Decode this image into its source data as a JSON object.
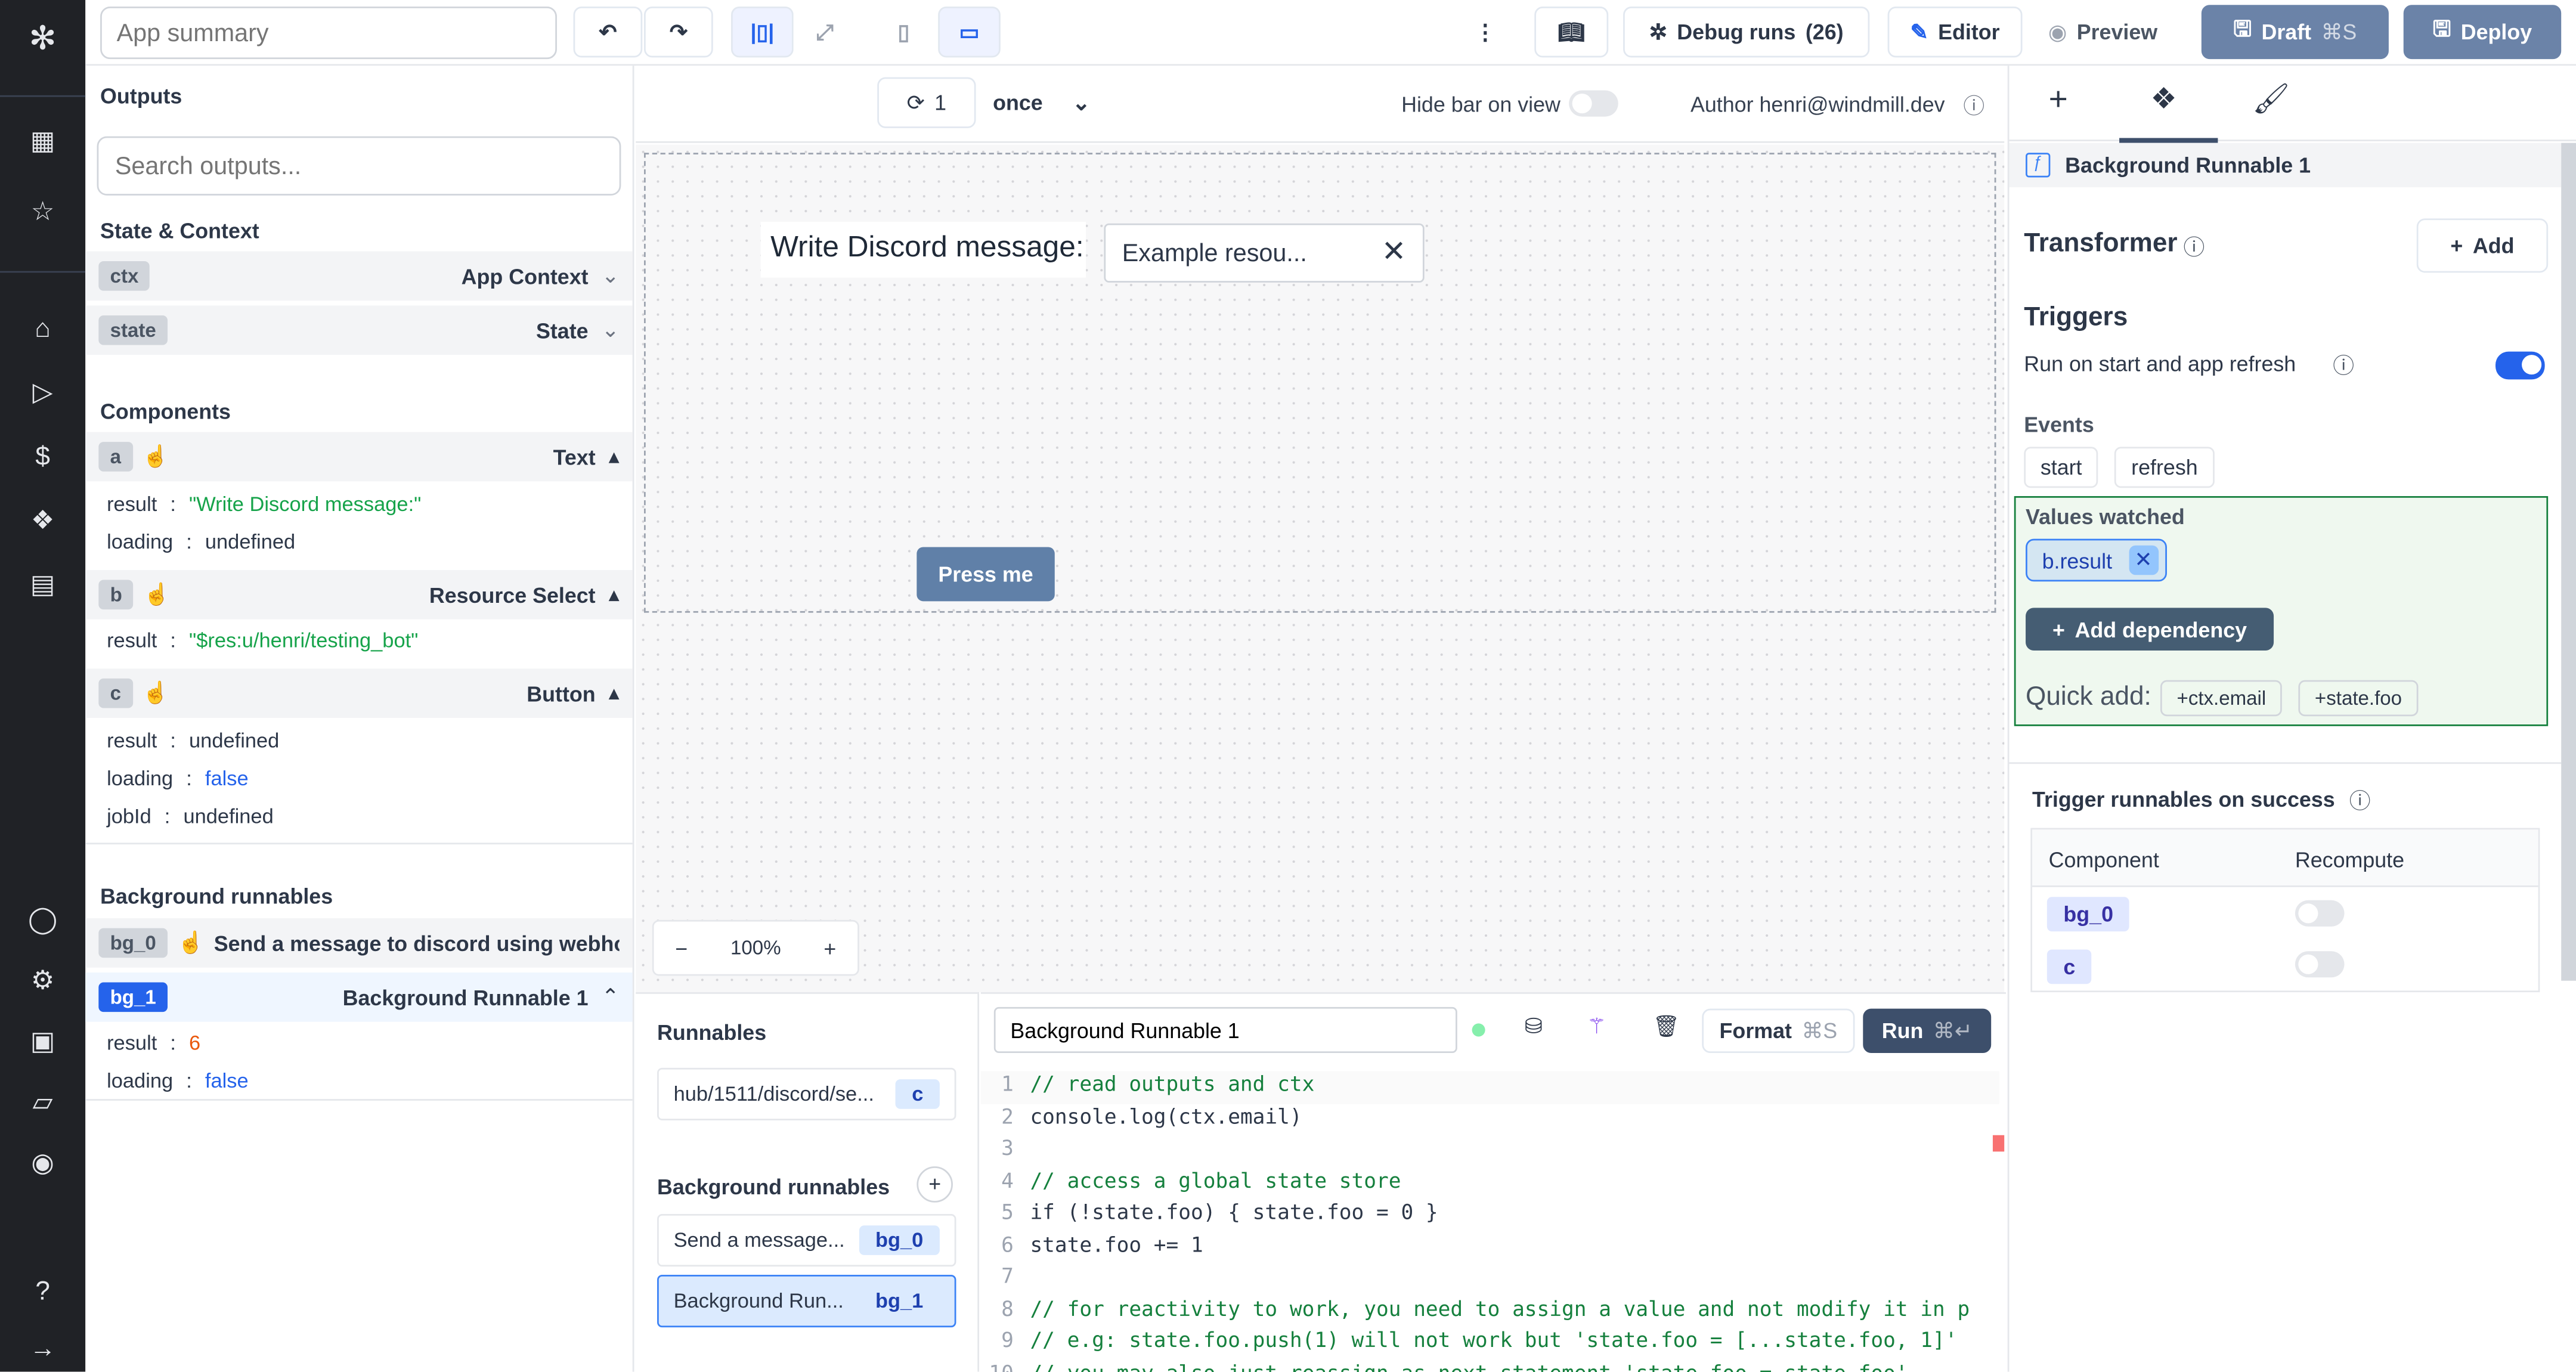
{
  "header": {
    "app_summary_placeholder": "App summary",
    "debug_runs": "Debug runs",
    "debug_count": "(26)",
    "editor": "Editor",
    "preview": "Preview",
    "draft": "Draft",
    "draft_shortcut": "⌘S",
    "deploy": "Deploy"
  },
  "canvas_bar": {
    "refresh_count": "1",
    "frequency": "once",
    "hide_bar_label": "Hide bar on view",
    "author": "Author henri@windmill.dev"
  },
  "outputs": {
    "title": "Outputs",
    "search_placeholder": "Search outputs...",
    "state_context_title": "State & Context",
    "ctx": {
      "tag": "ctx",
      "label": "App Context"
    },
    "state": {
      "tag": "state",
      "label": "State"
    },
    "components_title": "Components",
    "components": [
      {
        "id": "a",
        "label": "Text",
        "fields": [
          {
            "k": "result",
            "v": "\"Write Discord message:\""
          },
          {
            "k": "loading",
            "v": "undefined"
          }
        ]
      },
      {
        "id": "b",
        "label": "Resource Select",
        "fields": [
          {
            "k": "result",
            "v": "\"$res:u/henri/testing_bot\""
          }
        ]
      },
      {
        "id": "c",
        "label": "Button",
        "fields": [
          {
            "k": "result",
            "v": "undefined"
          },
          {
            "k": "loading",
            "v": "false"
          },
          {
            "k": "jobId",
            "v": "undefined"
          }
        ]
      }
    ],
    "bg_title": "Background runnables",
    "bg": [
      {
        "id": "bg_0",
        "label": "Send a message to discord using webhoo"
      },
      {
        "id": "bg_1",
        "label": "Background Runnable 1",
        "fields": [
          {
            "k": "result",
            "v": "6"
          },
          {
            "k": "loading",
            "v": "false"
          }
        ]
      }
    ]
  },
  "app": {
    "text": "Write Discord message:",
    "select_value": "Example resou...",
    "button": "Press me",
    "zoom": "100%"
  },
  "runnables": {
    "title": "Runnables",
    "items": [
      {
        "label": "hub/1511/discord/se...",
        "tag": "c"
      }
    ],
    "bg_title": "Background runnables",
    "bg_items": [
      {
        "label": "Send a message...",
        "tag": "bg_0"
      },
      {
        "label": "Background Run...",
        "tag": "bg_1"
      }
    ]
  },
  "editor": {
    "name": "Background Runnable 1",
    "format": "Format",
    "format_shortcut": "⌘S",
    "run": "Run",
    "run_shortcut": "⌘↵",
    "lines": [
      "// read outputs and ctx",
      "console.log(ctx.email)",
      "",
      "// access a global state store",
      "if (!state.foo) { state.foo = 0 }",
      "state.foo += 1",
      "",
      "// for reactivity to work, you need to assign a value and not modify it in p",
      "// e.g: state.foo.push(1) will not work but 'state.foo = [...state.foo, 1]'",
      "// you may also just reassign as next statement 'state.foo = state.foo'"
    ]
  },
  "settings": {
    "title": "Background Runnable 1",
    "transformer": "Transformer",
    "add": "Add",
    "triggers": "Triggers",
    "run_on_start": "Run on start and app refresh",
    "run_on_start_enabled": true,
    "events_title": "Events",
    "events": [
      "start",
      "refresh"
    ],
    "values_watched": "Values watched",
    "watched": [
      "b.result"
    ],
    "add_dependency": "Add dependency",
    "quick_add": "Quick add:",
    "quick": [
      "+ctx.email",
      "+state.foo"
    ],
    "trigger_on_success": "Trigger runnables on success",
    "table_headers": [
      "Component",
      "Recompute"
    ],
    "table_rows": [
      {
        "component": "bg_0",
        "recompute": false
      },
      {
        "component": "c",
        "recompute": false
      }
    ]
  }
}
